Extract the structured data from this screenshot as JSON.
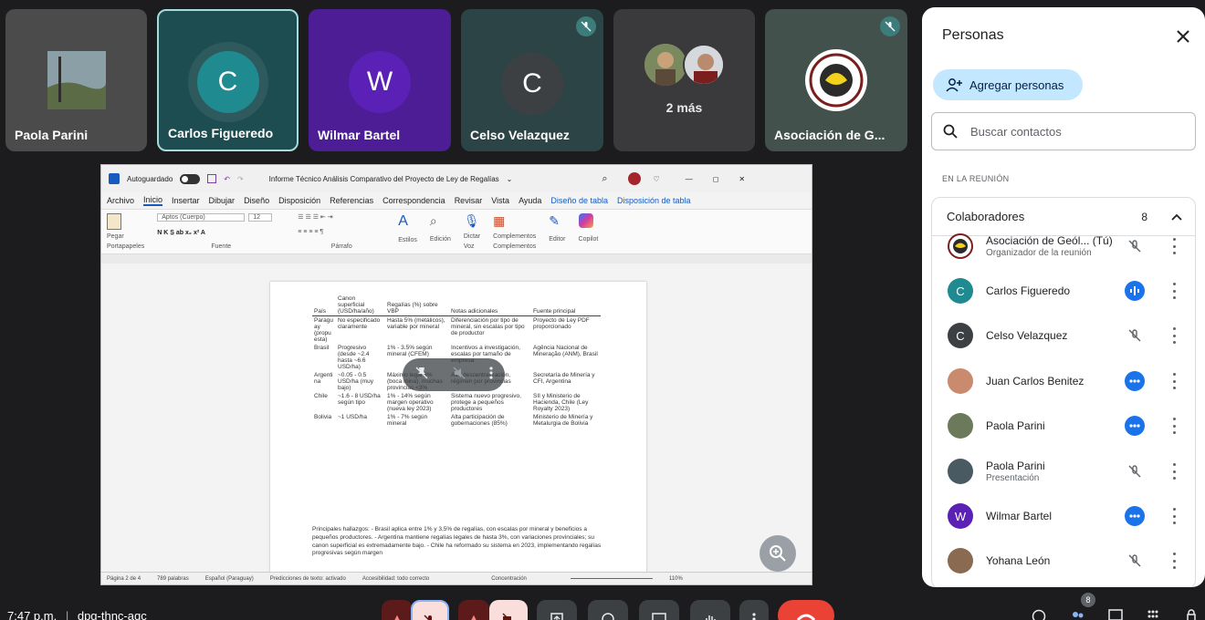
{
  "tiles": [
    {
      "name": "Paola Parini"
    },
    {
      "name": "Carlos Figueredo",
      "initial": "C"
    },
    {
      "name": "Wilmar Bartel",
      "initial": "W"
    },
    {
      "name": "Celso Velazquez",
      "initial": "C"
    },
    {
      "name": "2 más"
    },
    {
      "name": "Asociación de G..."
    }
  ],
  "doc": {
    "autosave": "Autoguardado",
    "title": "Informe Técnico Análisis Comparativo del Proyecto de Ley de Regalías",
    "menu": [
      "Archivo",
      "Inicio",
      "Insertar",
      "Dibujar",
      "Diseño",
      "Disposición",
      "Referencias",
      "Correspondencia",
      "Revisar",
      "Vista",
      "Ayuda",
      "Diseño de tabla",
      "Disposición de tabla"
    ],
    "ribbon": {
      "paste": "Pegar",
      "clipboard": "Portapapeles",
      "font_name": "Aptos (Cuerpo)",
      "font_size": "12",
      "font": "Fuente",
      "paragraph": "Párrafo",
      "styles": "Estilos",
      "editing": "Edición",
      "dictate": "Dictar",
      "voice": "Voz",
      "addins": "Complementos",
      "editor": "Editor",
      "copilot": "Copilot"
    },
    "table": {
      "headers": [
        "País",
        "Canon superficial (USD/ha/año)",
        "Regalías (%) sobre VBP",
        "Notas adicionales",
        "Fuente principal"
      ],
      "rows": [
        [
          "Paraguay (propuesta)",
          "No especificado claramente",
          "Hasta 5% (metálicos), variable por mineral",
          "Diferenciación por tipo de mineral, sin escalas por tipo de productor",
          "Proyecto de Ley PDF proporcionado"
        ],
        [
          "Brasil",
          "Progresivo (desde ~2.4 hasta ~6.6 USD/ha)",
          "1% - 3.5% según mineral (CFEM)",
          "Incentivos a investigación, escalas por tamaño de empresa",
          "Agência Nacional de Mineração (ANM), Brasil"
        ],
        [
          "Argentina",
          "~0.05 - 0.5 USD/ha (muy bajo)",
          "Máximo legal 3% (boca mina), muchas provincias <3%",
          "Alta descentralización, régimen por provincias",
          "Secretaría de Minería y CFI, Argentina"
        ],
        [
          "Chile",
          "~1.6 - 8 USD/ha según tipo",
          "1% - 14% según margen operativo (nueva ley 2023)",
          "Sistema nuevo progresivo, protege a pequeños productores",
          "SII y Ministerio de Hacienda, Chile (Ley Royalty 2023)"
        ],
        [
          "Bolivia",
          "~1 USD/ha",
          "1% - 7% según mineral",
          "Alta participación de gobernaciones (85%)",
          "Ministerio de Minería y Metalurgia de Bolivia"
        ]
      ]
    },
    "findings": "Principales hallazgos: - Brasil aplica entre 1% y 3,5% de regalías, con escalas por mineral y beneficios a pequeños productores. - Argentina mantiene regalías legales de hasta 3%, con variaciones provinciales; su canon superficial es extremadamente bajo. - Chile ha reformado su sistema en 2023, implementando regalías progresivas según margen",
    "status": {
      "page": "Página 2 de 4",
      "words": "789 palabras",
      "lang": "Español (Paraguay)",
      "predictions": "Predicciones de texto: activado",
      "accessibility": "Accesibilidad: todo correcto",
      "focus": "Concentración",
      "zoom": "110%"
    }
  },
  "panel": {
    "title": "Personas",
    "add": "Agregar personas",
    "search_placeholder": "Buscar contactos",
    "section": "EN LA REUNIÓN",
    "group": "Colaboradores",
    "count": "8",
    "people": [
      {
        "name": "Asociación de Geól...  (Tú)",
        "role": "Organizador de la reunión",
        "status": "muted"
      },
      {
        "name": "Carlos Figueredo",
        "initial": "C",
        "status": "speaking"
      },
      {
        "name": "Celso Velazquez",
        "initial": "C",
        "status": "muted"
      },
      {
        "name": "Juan Carlos Benitez",
        "status": "active"
      },
      {
        "name": "Paola Parini",
        "status": "active"
      },
      {
        "name": "Paola Parini",
        "role": "Presentación",
        "status": "muted"
      },
      {
        "name": "Wilmar Bartel",
        "initial": "W",
        "status": "active"
      },
      {
        "name": "Yohana León",
        "status": "muted"
      }
    ]
  },
  "bottom": {
    "time": "7:47 p.m.",
    "code": "dpg-thnc-aqc",
    "participant_badge": "8"
  },
  "colors": {
    "carlos": "#1f8a8f",
    "wilmar": "#5b21b6",
    "celso": "#3c4043",
    "end_call": "#ea4335",
    "accent": "#1a73e8"
  }
}
